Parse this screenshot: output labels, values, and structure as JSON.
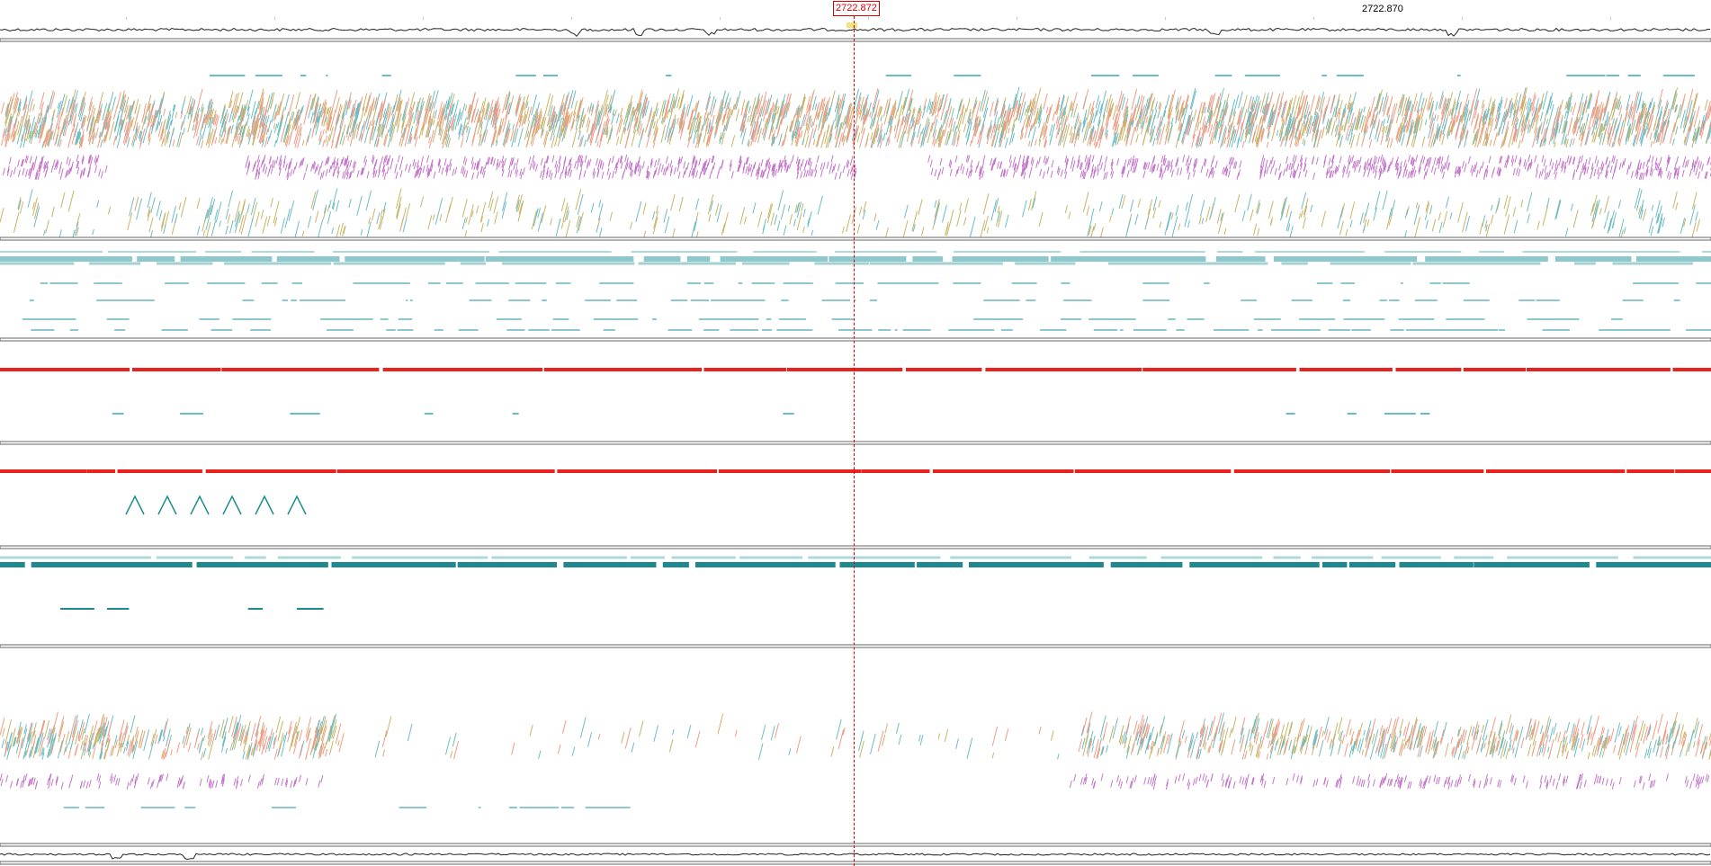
{
  "ruler": {
    "cursor_position": "2722.872",
    "position_label": "2722.870"
  },
  "colors": {
    "olive": "#c8b467",
    "teal": "#6cbcc4",
    "salmon": "#f29a86",
    "purple": "#c376c9",
    "seq_teal": "#8cc8cc",
    "dark_teal": "#1e8a8f",
    "red": "#e8221e",
    "separator": "#666666",
    "cursor": "#dd0000"
  },
  "tracks": [
    {
      "id": "coverage-top",
      "kind": "coverage"
    },
    {
      "id": "reads-1",
      "kind": "reads"
    },
    {
      "id": "sequences-1",
      "kind": "sequence-bars"
    },
    {
      "id": "alignment-red-1",
      "kind": "red-line"
    },
    {
      "id": "alignment-red-2",
      "kind": "red-line"
    },
    {
      "id": "sequences-2",
      "kind": "teal-bars"
    },
    {
      "id": "reads-2",
      "kind": "reads"
    },
    {
      "id": "coverage-bottom",
      "kind": "coverage"
    }
  ]
}
